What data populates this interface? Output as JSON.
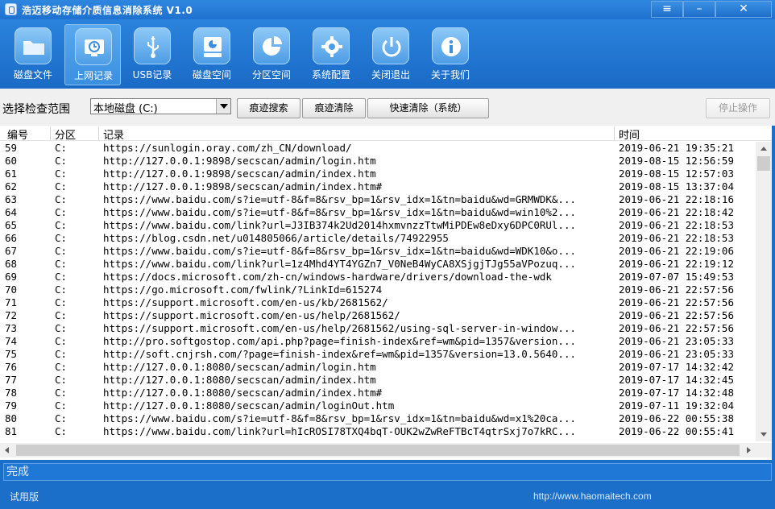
{
  "window": {
    "title": "浩迈移动存储介质信息消除系统 V1.0",
    "menu_glyph": "≡",
    "min_glyph": "–",
    "close_glyph": "✕"
  },
  "toolbar": [
    {
      "label": "磁盘文件",
      "icon": "folder-icon",
      "active": false
    },
    {
      "label": "上网记录",
      "icon": "browser-history-icon",
      "active": true
    },
    {
      "label": "USB记录",
      "icon": "usb-icon",
      "active": false
    },
    {
      "label": "磁盘空间",
      "icon": "disk-space-icon",
      "active": false
    },
    {
      "label": "分区空间",
      "icon": "pie-chart-icon",
      "active": false
    },
    {
      "label": "系统配置",
      "icon": "gear-icon",
      "active": false
    },
    {
      "label": "关闭退出",
      "icon": "power-icon",
      "active": false
    },
    {
      "label": "关于我们",
      "icon": "info-icon",
      "active": false
    }
  ],
  "filter": {
    "range_label": "选择检查范围",
    "selected_disk": "本地磁盘 (C:)",
    "search_button": "痕迹搜索",
    "clear_button": "痕迹清除",
    "quick_clear_button": "快速清除（系统）",
    "stop_button": "停止操作"
  },
  "columns": {
    "no": "编号",
    "partition": "分区",
    "record": "记录",
    "time": "时间"
  },
  "rows": [
    {
      "no": "59",
      "part": "C:",
      "rec": "https://sunlogin.oray.com/zh_CN/download/",
      "time": "2019-06-21 19:35:21"
    },
    {
      "no": "60",
      "part": "C:",
      "rec": "http://127.0.0.1:9898/secscan/admin/login.htm",
      "time": "2019-08-15 12:56:59"
    },
    {
      "no": "61",
      "part": "C:",
      "rec": "http://127.0.0.1:9898/secscan/admin/index.htm",
      "time": "2019-08-15 12:57:03"
    },
    {
      "no": "62",
      "part": "C:",
      "rec": "http://127.0.0.1:9898/secscan/admin/index.htm#",
      "time": "2019-08-15 13:37:04"
    },
    {
      "no": "63",
      "part": "C:",
      "rec": "https://www.baidu.com/s?ie=utf-8&f=8&rsv_bp=1&rsv_idx=1&tn=baidu&wd=GRMWDK&...",
      "time": "2019-06-21 22:18:16"
    },
    {
      "no": "64",
      "part": "C:",
      "rec": "https://www.baidu.com/s?ie=utf-8&f=8&rsv_bp=1&rsv_idx=1&tn=baidu&wd=win10%2...",
      "time": "2019-06-21 22:18:42"
    },
    {
      "no": "65",
      "part": "C:",
      "rec": "https://www.baidu.com/link?url=J3IB374k2Ud2014hxmvnzzTtwMiPDEw8eDxy6DPC0RUl...",
      "time": "2019-06-21 22:18:53"
    },
    {
      "no": "66",
      "part": "C:",
      "rec": "https://blog.csdn.net/u014805066/article/details/74922955",
      "time": "2019-06-21 22:18:53"
    },
    {
      "no": "67",
      "part": "C:",
      "rec": "https://www.baidu.com/s?ie=utf-8&f=8&rsv_bp=1&rsv_idx=1&tn=baidu&wd=WDK10&o...",
      "time": "2019-06-21 22:19:06"
    },
    {
      "no": "68",
      "part": "C:",
      "rec": "https://www.baidu.com/link?url=1z4Mhd4YT4YGZn7_V0NeB4WyCA8XSjgjTJg55aVPozuq...",
      "time": "2019-06-21 22:19:12"
    },
    {
      "no": "69",
      "part": "C:",
      "rec": "https://docs.microsoft.com/zh-cn/windows-hardware/drivers/download-the-wdk",
      "time": "2019-07-07 15:49:53"
    },
    {
      "no": "70",
      "part": "C:",
      "rec": "https://go.microsoft.com/fwlink/?LinkId=615274",
      "time": "2019-06-21 22:57:56"
    },
    {
      "no": "71",
      "part": "C:",
      "rec": "https://support.microsoft.com/en-us/kb/2681562/",
      "time": "2019-06-21 22:57:56"
    },
    {
      "no": "72",
      "part": "C:",
      "rec": "https://support.microsoft.com/en-us/help/2681562/",
      "time": "2019-06-21 22:57:56"
    },
    {
      "no": "73",
      "part": "C:",
      "rec": "https://support.microsoft.com/en-us/help/2681562/using-sql-server-in-window...",
      "time": "2019-06-21 22:57:56"
    },
    {
      "no": "74",
      "part": "C:",
      "rec": "http://pro.softgostop.com/api.php?page=finish-index&ref=wm&pid=1357&version...",
      "time": "2019-06-21 23:05:33"
    },
    {
      "no": "75",
      "part": "C:",
      "rec": "http://soft.cnjrsh.com/?page=finish-index&ref=wm&pid=1357&version=13.0.5640...",
      "time": "2019-06-21 23:05:33"
    },
    {
      "no": "76",
      "part": "C:",
      "rec": "http://127.0.0.1:8080/secscan/admin/login.htm",
      "time": "2019-07-17 14:32:42"
    },
    {
      "no": "77",
      "part": "C:",
      "rec": "http://127.0.0.1:8080/secscan/admin/index.htm",
      "time": "2019-07-17 14:32:45"
    },
    {
      "no": "78",
      "part": "C:",
      "rec": "http://127.0.0.1:8080/secscan/admin/index.htm#",
      "time": "2019-07-17 14:32:48"
    },
    {
      "no": "79",
      "part": "C:",
      "rec": "http://127.0.0.1:8080/secscan/admin/loginOut.htm",
      "time": "2019-07-11 19:32:04"
    },
    {
      "no": "80",
      "part": "C:",
      "rec": "https://www.baidu.com/s?ie=utf-8&f=8&rsv_bp=1&rsv_idx=1&tn=baidu&wd=x1%20ca...",
      "time": "2019-06-22 00:55:38"
    },
    {
      "no": "81",
      "part": "C:",
      "rec": "https://www.baidu.com/link?url=hIcROSI78TXQ4bqT-OUK2wZwReFTBcT4qtrSxj7o7kRC...",
      "time": "2019-06-22 00:55:41"
    }
  ],
  "status": {
    "message": "完成"
  },
  "footer": {
    "trial": "试用版",
    "url": "http://www.haomaitech.com"
  },
  "colors": {
    "chrome_blue": "#1b6fc8",
    "active_tab": "#3a8fe0"
  }
}
